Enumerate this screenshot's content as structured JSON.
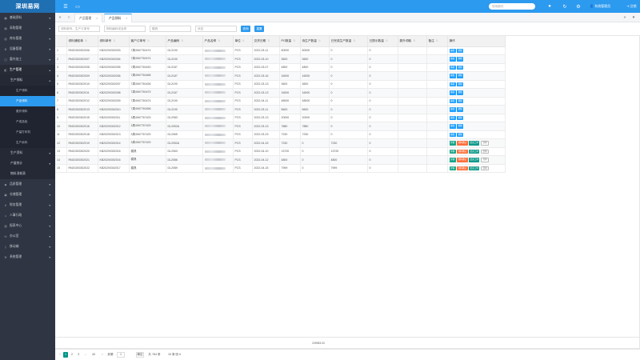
{
  "app": {
    "title": "深圳易网",
    "search_placeholder": "搜索模块",
    "user": "系统管理员",
    "logout": "注销"
  },
  "sidebar": {
    "top": [
      {
        "label": "基础资料"
      },
      {
        "label": "采购管理"
      },
      {
        "label": "库存管理"
      },
      {
        "label": "设备管理"
      },
      {
        "label": "委外加工"
      },
      {
        "label": "生产管理"
      }
    ],
    "group": "生产领料",
    "leaves": [
      {
        "label": "生产领料",
        "active": false
      },
      {
        "label": "产品领料",
        "active": true
      },
      {
        "label": "委外领料",
        "active": false
      },
      {
        "label": "产成品检",
        "active": false
      },
      {
        "label": "产量打印机",
        "active": false
      },
      {
        "label": "生产余料",
        "active": false
      }
    ],
    "subs": [
      {
        "label": "生产资料"
      },
      {
        "label": "产量统计"
      },
      {
        "label": "物料消耗表"
      }
    ],
    "bottom": [
      {
        "label": "品质管理"
      },
      {
        "label": "仓储管理"
      },
      {
        "label": "财务管理"
      },
      {
        "label": "人事行政"
      },
      {
        "label": "报表中心"
      },
      {
        "label": "办公室"
      },
      {
        "label": "移动端"
      },
      {
        "label": "系统管理"
      }
    ]
  },
  "tabs": [
    {
      "label": "产品管理"
    },
    {
      "label": "产品领料"
    }
  ],
  "filters": {
    "f1": "领料单号、生产订单号",
    "f2": "物料编码或名称",
    "f3": "模具",
    "f4": "状态",
    "search": "查询",
    "reset": "重置"
  },
  "table": {
    "columns": [
      "领料通知单",
      "领料单号",
      "客户订单号",
      "产品编码",
      "产品名称",
      "单位",
      "交货日期",
      "PO数量",
      "待生产数量",
      "已完成生产数量",
      "已提示数量",
      "委外领取",
      "备注",
      "操作"
    ],
    "rows": [
      {
        "n": "1",
        "a": "RN20200302006",
        "b": "KB20200302003",
        "c": "7周4967760474",
        "d": "DL2190",
        "u": "PCS",
        "dt": "2022-03-11",
        "po": "50000",
        "wait": "50000",
        "done": "0",
        "tip": "0",
        "ops": [
          "edit",
          "del"
        ]
      },
      {
        "n": "2",
        "a": "RN20200302007",
        "b": "KB20200302004",
        "c": "7周4967760474",
        "d": "DL2190",
        "u": "PCS",
        "dt": "2022-03-10",
        "po": "3600",
        "wait": "3600",
        "done": "0",
        "tip": "0",
        "ops": [
          "edit",
          "del"
        ]
      },
      {
        "n": "3",
        "a": "RN20200302008",
        "b": "KB20200302005",
        "c": "7周4967760430",
        "d": "DL2187",
        "u": "PCS",
        "dt": "2022-03-07",
        "po": "4800",
        "wait": "4800",
        "done": "0",
        "tip": "0",
        "ops": [
          "edit",
          "del"
        ]
      },
      {
        "n": "4",
        "a": "RN20200302009",
        "b": "KB20200302006",
        "c": "7周4967760468",
        "d": "DL2187",
        "u": "PCS",
        "dt": "2022-03-16",
        "po": "16000",
        "wait": "16000",
        "done": "0",
        "tip": "0",
        "ops": [
          "edit",
          "del"
        ]
      },
      {
        "n": "5",
        "a": "RN20200302010",
        "b": "KB20200302007",
        "c": "7周4967760436",
        "d": "DL2190",
        "u": "PCS",
        "dt": "2022-03-13",
        "po": "3600",
        "wait": "3600",
        "done": "0",
        "tip": "0",
        "ops": [
          "edit",
          "del"
        ]
      },
      {
        "n": "6",
        "a": "RN20200302011",
        "b": "KB20200302008",
        "c": "7周4967760479",
        "d": "DL2187",
        "u": "PCS",
        "dt": "2022-03-13",
        "po": "16000",
        "wait": "16000",
        "done": "0",
        "tip": "0",
        "ops": [
          "edit",
          "del"
        ]
      },
      {
        "n": "7",
        "a": "RN20200302012",
        "b": "KB20200302009",
        "c": "7周4967760474",
        "d": "DL2190",
        "u": "PCS",
        "dt": "2022-04-11",
        "po": "48000",
        "wait": "48000",
        "done": "0",
        "tip": "0",
        "ops": [
          "edit",
          "del"
        ]
      },
      {
        "n": "8",
        "a": "RN20200302013",
        "b": "KB20200302010",
        "c": "7周4967760458",
        "d": "DL2190",
        "u": "PCS",
        "dt": "2022-03-11",
        "po": "5600",
        "wait": "5600",
        "done": "0",
        "tip": "0",
        "ops": [
          "edit",
          "del"
        ]
      },
      {
        "n": "9",
        "a": "RN20200302015",
        "b": "KB20200302011",
        "c": "3周4967767429",
        "d": "DL2083",
        "u": "PCS",
        "dt": "2022-03-13",
        "po": "20000",
        "wait": "20000",
        "done": "0",
        "tip": "0",
        "ops": [
          "edit",
          "del"
        ]
      },
      {
        "n": "10",
        "a": "RN20200302016",
        "b": "KB20200302012",
        "c": "3周4967767429",
        "d": "DL2052A",
        "u": "PCS",
        "dt": "2022-03-13",
        "po": "7880",
        "wait": "7880",
        "done": "0",
        "tip": "0",
        "ops": [
          "edit",
          "del"
        ]
      },
      {
        "n": "11",
        "a": "RN20200302018",
        "b": "KB20200302013",
        "c": "3周4967767429",
        "d": "DL2065",
        "u": "PCS",
        "dt": "2022-03-23",
        "po": "7230",
        "wait": "7230",
        "done": "0",
        "tip": "0",
        "ops": [
          "edit",
          "del"
        ]
      },
      {
        "n": "12",
        "a": "RN20200302019",
        "b": "KB20200302014",
        "c": "3周4967767429",
        "d": "DL2052A",
        "u": "PCS",
        "dt": "2022-04-15",
        "po": "7230",
        "wait": "0",
        "done": "7230",
        "tip": "0",
        "ops": [
          "detail",
          "issue",
          "close",
          "print"
        ]
      },
      {
        "n": "13",
        "a": "RN20200302020",
        "b": "KB20200302015",
        "c": "模具",
        "d": "DL2063",
        "u": "PCS",
        "dt": "2022-04-10",
        "po": "13720",
        "wait": "0",
        "done": "13720",
        "tip": "0",
        "ops": [
          "detail",
          "issue",
          "close",
          "print"
        ]
      },
      {
        "n": "14",
        "a": "RN20200302021",
        "b": "KB20200302016",
        "c": "模具",
        "d": "DL2086",
        "u": "PCS",
        "dt": "2022-04-12",
        "po": "4800",
        "wait": "0",
        "done": "4800",
        "tip": "0",
        "ops": [
          "detail",
          "issue",
          "close",
          "print"
        ]
      },
      {
        "n": "15",
        "a": "RN20200302022",
        "b": "KB20200302017",
        "c": "模具",
        "d": "DL2089",
        "u": "PCS",
        "dt": "2022-04-15",
        "po": "7999",
        "wait": "0",
        "done": "7999",
        "tip": "0",
        "ops": [
          "detail",
          "issue",
          "close",
          "print"
        ]
      }
    ],
    "op_labels": {
      "edit": "编辑",
      "del": "删除",
      "detail": "详情",
      "issue": "领料确认",
      "close": "结束工单",
      "print": "打印"
    },
    "total": "205983.00"
  },
  "pager": {
    "pages": [
      "1",
      "2",
      "3",
      "...",
      "40"
    ],
    "goto_label": "到第",
    "goto_value": "1",
    "go": "确定",
    "total": "共 784 条",
    "per_page": "15 条/页"
  },
  "colors": {
    "topbar": "#2c9aef",
    "sidebar": "#2f3542",
    "active": "#2c9aef",
    "pager_current": "#009688"
  }
}
